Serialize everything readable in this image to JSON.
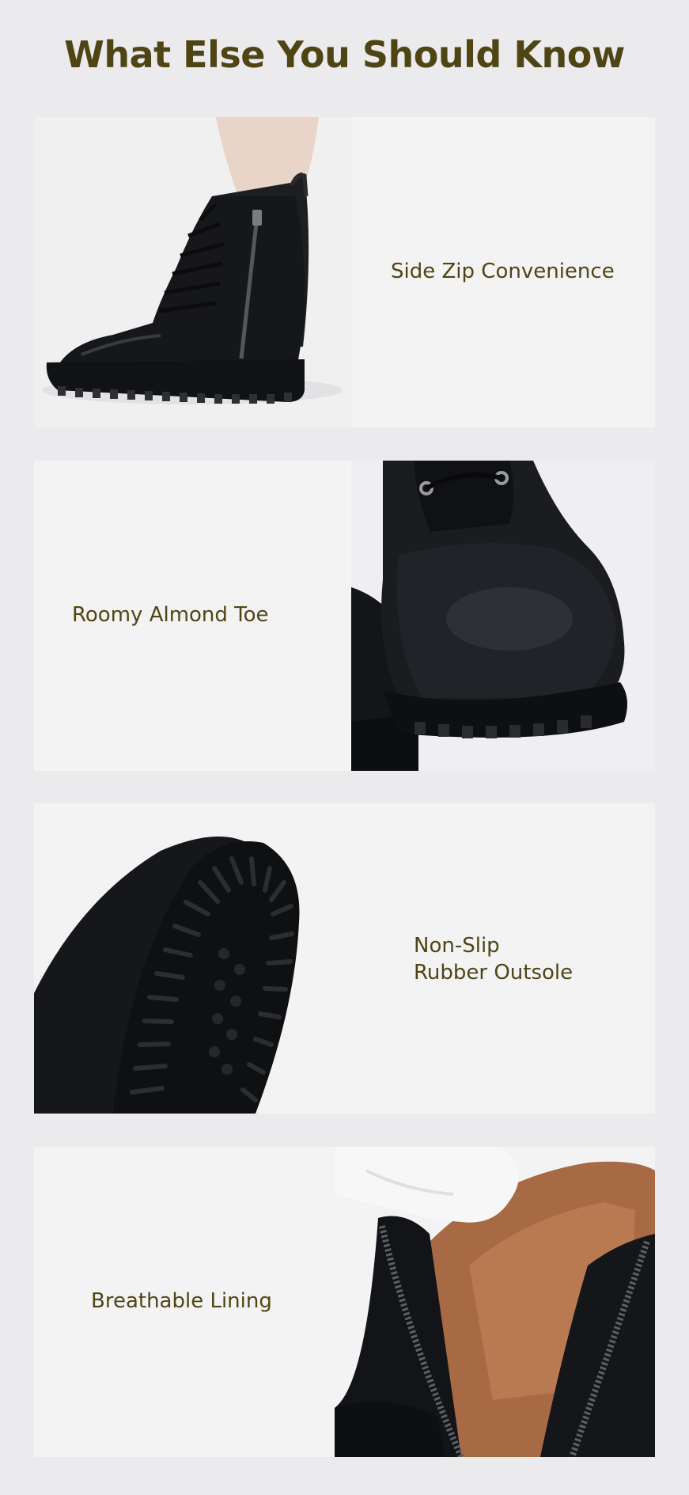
{
  "title": "What Else You Should Know",
  "features": [
    {
      "label_lines": [
        "Side Zip Convenience"
      ],
      "image": "boot-side-zip-photo"
    },
    {
      "label_lines": [
        "Roomy Almond Toe"
      ],
      "image": "boot-toe-photo"
    },
    {
      "label_lines": [
        "Non-Slip",
        "Rubber Outsole"
      ],
      "image": "boot-outsole-photo"
    },
    {
      "label_lines": [
        "Breathable Lining"
      ],
      "image": "boot-lining-photo"
    }
  ],
  "colors": {
    "title": "#4f4514",
    "label": "#4f4514",
    "background": "#ebebed",
    "card": "#f3f3f4"
  }
}
